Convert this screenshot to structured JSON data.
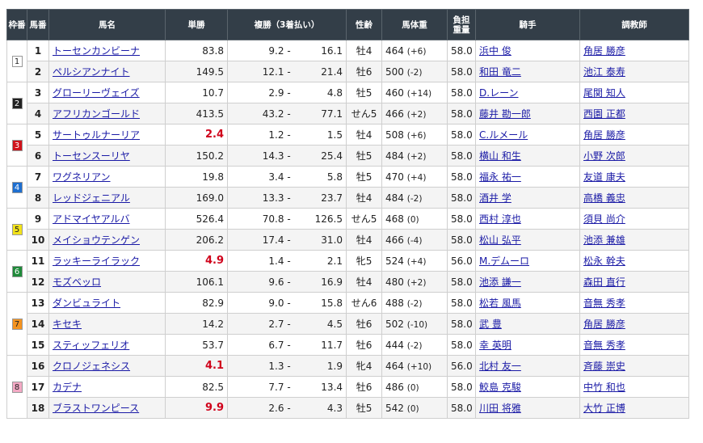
{
  "headers": {
    "waku": "枠番",
    "umaban": "馬番",
    "horse": "馬名",
    "win": "単勝",
    "place": "複勝（3着払い）",
    "sexage": "性齢",
    "weight": "馬体重",
    "burden1": "負担",
    "burden2": "重量",
    "jockey": "騎手",
    "trainer": "調教師"
  },
  "place_sep": "-",
  "waku_colors": {
    "1": {
      "bg": "#ffffff",
      "fg": "#222222"
    },
    "2": {
      "bg": "#222222",
      "fg": "#ffffff"
    },
    "3": {
      "bg": "#d0121b",
      "fg": "#ffffff"
    },
    "4": {
      "bg": "#1e6fd0",
      "fg": "#ffffff"
    },
    "5": {
      "bg": "#f2e21a",
      "fg": "#222222"
    },
    "6": {
      "bg": "#1f8a3a",
      "fg": "#ffffff"
    },
    "7": {
      "bg": "#f5931e",
      "fg": "#222222"
    },
    "8": {
      "bg": "#f3a9c4",
      "fg": "#222222"
    }
  },
  "rows": [
    {
      "waku": "1",
      "umaban": "1",
      "horse": "トーセンカンビーナ",
      "win": "83.8",
      "fav": false,
      "place_low": "9.2",
      "place_high": "16.1",
      "sexage": "牡4",
      "weight": "464",
      "weight_diff": "(+6)",
      "burden": "58.0",
      "jockey": "浜中 俊",
      "trainer": "角居 勝彦"
    },
    {
      "waku": "1",
      "umaban": "2",
      "horse": "ペルシアンナイト",
      "win": "149.5",
      "fav": false,
      "place_low": "12.1",
      "place_high": "21.4",
      "sexage": "牡6",
      "weight": "500",
      "weight_diff": "(-2)",
      "burden": "58.0",
      "jockey": "和田 竜二",
      "trainer": "池江 泰寿"
    },
    {
      "waku": "2",
      "umaban": "3",
      "horse": "グローリーヴェイズ",
      "win": "10.7",
      "fav": false,
      "place_low": "2.9",
      "place_high": "4.8",
      "sexage": "牡5",
      "weight": "460",
      "weight_diff": "(+14)",
      "burden": "58.0",
      "jockey": "D.レーン",
      "trainer": "尾関 知人"
    },
    {
      "waku": "2",
      "umaban": "4",
      "horse": "アフリカンゴールド",
      "win": "413.5",
      "fav": false,
      "place_low": "43.2",
      "place_high": "77.1",
      "sexage": "せん5",
      "weight": "466",
      "weight_diff": "(+2)",
      "burden": "58.0",
      "jockey": "藤井 勘一郎",
      "trainer": "西園 正都"
    },
    {
      "waku": "3",
      "umaban": "5",
      "horse": "サートゥルナーリア",
      "win": "2.4",
      "fav": true,
      "place_low": "1.2",
      "place_high": "1.5",
      "sexage": "牡4",
      "weight": "508",
      "weight_diff": "(+6)",
      "burden": "58.0",
      "jockey": "C.ルメール",
      "trainer": "角居 勝彦"
    },
    {
      "waku": "3",
      "umaban": "6",
      "horse": "トーセンスーリヤ",
      "win": "150.2",
      "fav": false,
      "place_low": "14.3",
      "place_high": "25.4",
      "sexage": "牡5",
      "weight": "484",
      "weight_diff": "(+2)",
      "burden": "58.0",
      "jockey": "横山 和生",
      "trainer": "小野 次郎"
    },
    {
      "waku": "4",
      "umaban": "7",
      "horse": "ワグネリアン",
      "win": "19.8",
      "fav": false,
      "place_low": "3.4",
      "place_high": "5.8",
      "sexage": "牡5",
      "weight": "470",
      "weight_diff": "(+4)",
      "burden": "58.0",
      "jockey": "福永 祐一",
      "trainer": "友道 康夫"
    },
    {
      "waku": "4",
      "umaban": "8",
      "horse": "レッドジェニアル",
      "win": "169.0",
      "fav": false,
      "place_low": "13.3",
      "place_high": "23.7",
      "sexage": "牡4",
      "weight": "484",
      "weight_diff": "(-2)",
      "burden": "58.0",
      "jockey": "酒井 学",
      "trainer": "高橋 義忠"
    },
    {
      "waku": "5",
      "umaban": "9",
      "horse": "アドマイヤアルバ",
      "win": "526.4",
      "fav": false,
      "place_low": "70.8",
      "place_high": "126.5",
      "sexage": "せん5",
      "weight": "468",
      "weight_diff": "(0)",
      "burden": "58.0",
      "jockey": "西村 淳也",
      "trainer": "須貝 尚介"
    },
    {
      "waku": "5",
      "umaban": "10",
      "horse": "メイショウテンゲン",
      "win": "206.2",
      "fav": false,
      "place_low": "17.4",
      "place_high": "31.0",
      "sexage": "牡4",
      "weight": "466",
      "weight_diff": "(-4)",
      "burden": "58.0",
      "jockey": "松山 弘平",
      "trainer": "池添 兼雄"
    },
    {
      "waku": "6",
      "umaban": "11",
      "horse": "ラッキーライラック",
      "win": "4.9",
      "fav": true,
      "place_low": "1.4",
      "place_high": "2.1",
      "sexage": "牝5",
      "weight": "524",
      "weight_diff": "(+4)",
      "burden": "56.0",
      "jockey": "M.デムーロ",
      "trainer": "松永 幹夫"
    },
    {
      "waku": "6",
      "umaban": "12",
      "horse": "モズベッロ",
      "win": "106.1",
      "fav": false,
      "place_low": "9.6",
      "place_high": "16.9",
      "sexage": "牡4",
      "weight": "480",
      "weight_diff": "(+2)",
      "burden": "58.0",
      "jockey": "池添 謙一",
      "trainer": "森田 直行"
    },
    {
      "waku": "7",
      "umaban": "13",
      "horse": "ダンビュライト",
      "win": "82.9",
      "fav": false,
      "place_low": "9.0",
      "place_high": "15.8",
      "sexage": "せん6",
      "weight": "488",
      "weight_diff": "(-2)",
      "burden": "58.0",
      "jockey": "松若 風馬",
      "trainer": "音無 秀孝"
    },
    {
      "waku": "7",
      "umaban": "14",
      "horse": "キセキ",
      "win": "14.2",
      "fav": false,
      "place_low": "2.7",
      "place_high": "4.5",
      "sexage": "牡6",
      "weight": "502",
      "weight_diff": "(-10)",
      "burden": "58.0",
      "jockey": "武 豊",
      "trainer": "角居 勝彦"
    },
    {
      "waku": "7",
      "umaban": "15",
      "horse": "スティッフェリオ",
      "win": "53.7",
      "fav": false,
      "place_low": "6.7",
      "place_high": "11.7",
      "sexage": "牡6",
      "weight": "444",
      "weight_diff": "(-2)",
      "burden": "58.0",
      "jockey": "幸 英明",
      "trainer": "音無 秀孝"
    },
    {
      "waku": "8",
      "umaban": "16",
      "horse": "クロノジェネシス",
      "win": "4.1",
      "fav": true,
      "place_low": "1.3",
      "place_high": "1.9",
      "sexage": "牝4",
      "weight": "464",
      "weight_diff": "(+10)",
      "burden": "56.0",
      "jockey": "北村 友一",
      "trainer": "斉藤 崇史"
    },
    {
      "waku": "8",
      "umaban": "17",
      "horse": "カデナ",
      "win": "82.5",
      "fav": false,
      "place_low": "7.7",
      "place_high": "13.4",
      "sexage": "牡6",
      "weight": "486",
      "weight_diff": "(0)",
      "burden": "58.0",
      "jockey": "鮫島 克駿",
      "trainer": "中竹 和也"
    },
    {
      "waku": "8",
      "umaban": "18",
      "horse": "ブラストワンピース",
      "win": "9.9",
      "fav": true,
      "place_low": "2.6",
      "place_high": "4.3",
      "sexage": "牡5",
      "weight": "542",
      "weight_diff": "(0)",
      "burden": "58.0",
      "jockey": "川田 将雅",
      "trainer": "大竹 正博"
    }
  ]
}
